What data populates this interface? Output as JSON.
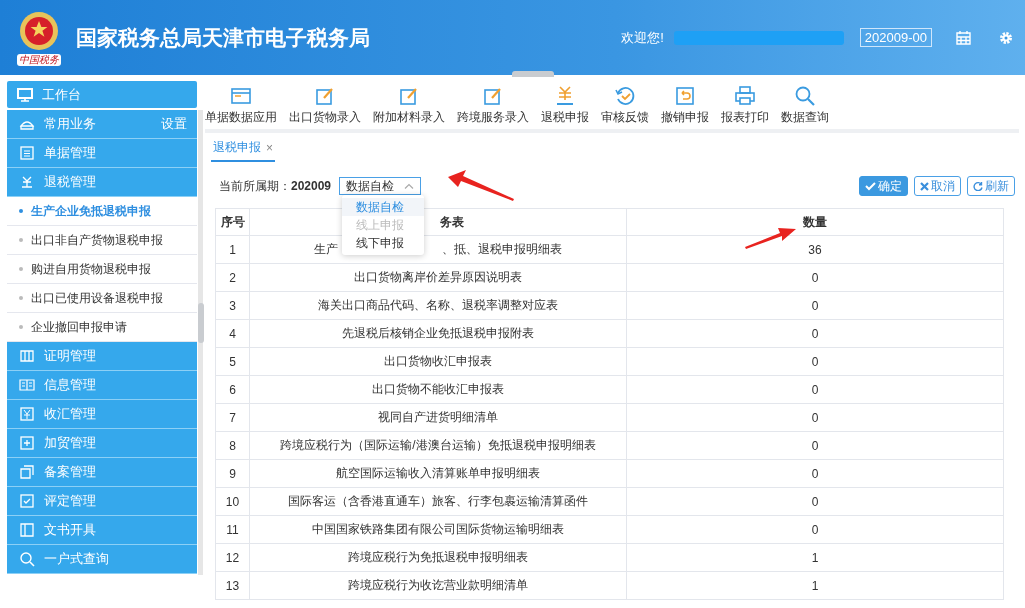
{
  "header": {
    "title": "国家税务总局天津市电子税务局",
    "logo_caption": "中国税务",
    "welcome": "欢迎您!",
    "period": "202009-00"
  },
  "sidebar": {
    "workbench": "工作台",
    "items": [
      {
        "label": "常用业务",
        "action": "设置"
      },
      {
        "label": "单据管理"
      },
      {
        "label": "退税管理",
        "children": [
          {
            "label": "生产企业免抵退税申报",
            "selected": true
          },
          {
            "label": "出口非自产货物退税申报",
            "selected": false
          },
          {
            "label": "购进自用货物退税申报",
            "selected": false
          },
          {
            "label": "出口已使用设备退税申报",
            "selected": false
          },
          {
            "label": "企业撤回申报申请",
            "selected": false
          }
        ]
      },
      {
        "label": "证明管理"
      },
      {
        "label": "信息管理"
      },
      {
        "label": "收汇管理"
      },
      {
        "label": "加贸管理"
      },
      {
        "label": "备案管理"
      },
      {
        "label": "评定管理"
      },
      {
        "label": "文书开具"
      },
      {
        "label": "一户式查询"
      }
    ]
  },
  "toolbar": [
    "单据数据应用",
    "出口货物录入",
    "附加材料录入",
    "跨境服务录入",
    "退税申报",
    "审核反馈",
    "撤销申报",
    "报表打印",
    "数据查询"
  ],
  "tabs": [
    {
      "label": "退税申报",
      "close": "×",
      "selected": true
    }
  ],
  "filter": {
    "label": "当前所属期：",
    "period": "202009",
    "select": "数据自检",
    "options": [
      {
        "label": "数据自检",
        "selected": true,
        "disabled": false
      },
      {
        "label": "线上申报",
        "selected": false,
        "disabled": true
      },
      {
        "label": "线下申报",
        "selected": false,
        "disabled": false
      }
    ]
  },
  "buttons": [
    {
      "label": "确定",
      "kind": "primary"
    },
    {
      "label": "取消",
      "kind": "cancel"
    },
    {
      "label": "刷新",
      "kind": "refresh"
    }
  ],
  "table": {
    "columns": [
      "序号",
      "务表",
      "数量"
    ],
    "rows": [
      {
        "no": "1",
        "name": [
          "生产",
          "、抵、退税申报明细表"
        ],
        "count": "36"
      },
      {
        "no": "2",
        "name": [
          "出口货物离岸价差异原因说明表"
        ],
        "count": "0"
      },
      {
        "no": "3",
        "name": [
          "海关出口商品代码、名称、退税率调整对应表"
        ],
        "count": "0"
      },
      {
        "no": "4",
        "name": [
          "先退税后核销企业免抵退税申报附表"
        ],
        "count": "0"
      },
      {
        "no": "5",
        "name": [
          "出口货物收汇申报表"
        ],
        "count": "0"
      },
      {
        "no": "6",
        "name": [
          "出口货物不能收汇申报表"
        ],
        "count": "0"
      },
      {
        "no": "7",
        "name": [
          "视同自产进货明细清单"
        ],
        "count": "0"
      },
      {
        "no": "8",
        "name": [
          "跨境应税行为（国际运输/港澳台运输）免抵退税申报明细表"
        ],
        "count": "0"
      },
      {
        "no": "9",
        "name": [
          "航空国际运输收入清算账单申报明细表"
        ],
        "count": "0"
      },
      {
        "no": "10",
        "name": [
          "国际客运（含香港直通车）旅客、行李包裹运输清算函件"
        ],
        "count": "0"
      },
      {
        "no": "11",
        "name": [
          "中国国家铁路集团有限公司国际货物运输明细表"
        ],
        "count": "0"
      },
      {
        "no": "12",
        "name": [
          "跨境应税行为免抵退税申报明细表"
        ],
        "count": "1"
      },
      {
        "no": "13",
        "name": [
          "跨境应税行为收讫营业款明细清单"
        ],
        "count": "1"
      }
    ]
  }
}
